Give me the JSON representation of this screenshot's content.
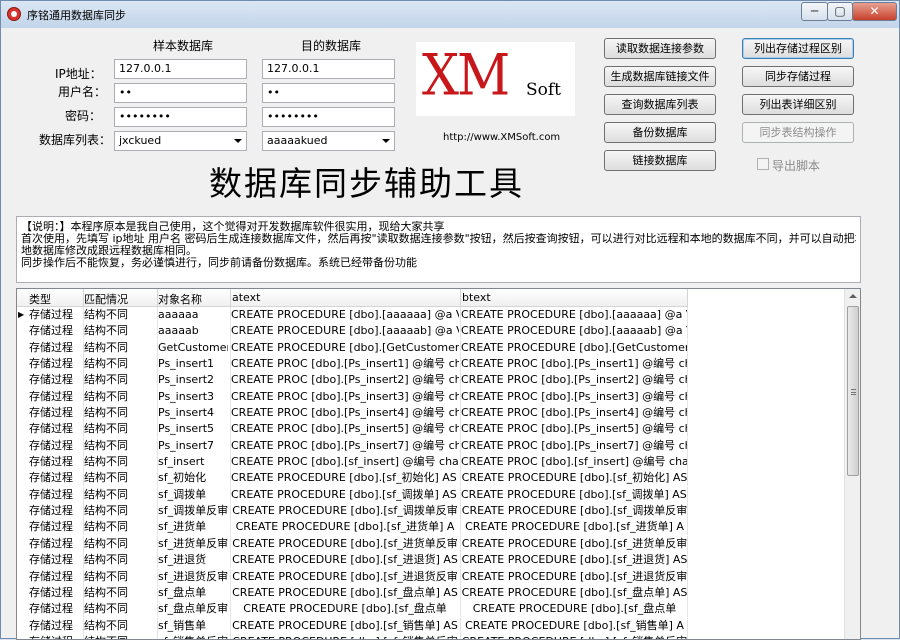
{
  "window": {
    "title": "序铭通用数据库同步",
    "min": "─",
    "max": "▢",
    "close": "✕"
  },
  "form": {
    "source_header": "样本数据库",
    "target_header": "目的数据库",
    "ip_label": "IP地址：",
    "user_label": "用户名：",
    "pwd_label": "密码：",
    "dblist_label": "数据库列表：",
    "source": {
      "ip": "127.0.0.1",
      "user": "••",
      "pwd": "••••••••",
      "db": "jxckued"
    },
    "target": {
      "ip": "127.0.0.1",
      "user": "••",
      "pwd": "••••••••",
      "db": "aaaaakued"
    }
  },
  "logo": {
    "xm": "XM",
    "soft": "Soft",
    "url": "http://www.XMSoft.com"
  },
  "app_title": "数据库同步辅助工具",
  "buttons": {
    "read_params": "读取数据连接参数",
    "gen_link": "生成数据库链接文件",
    "query_list": "查询数据库列表",
    "backup": "备份数据库",
    "link": "链接数据库",
    "list_proc_diff": "列出存储过程区别",
    "sync_proc": "同步存储过程",
    "list_table_diff": "列出表详细区别",
    "sync_table": "同步表结构操作",
    "export_script": "导出脚本"
  },
  "description": [
    "【说明：】本程序原本是我自己使用，这个觉得对开发数据库软件很实用，现给大家共享",
    "首次使用，先填写 ip地址 用户名 密码后生成连接数据库文件，然后再按\"读取数据连接参数\"按钮，然后按查询按钮，可以进行对比远程和本地的数据库不同，并可以自动把本",
    "地数据库修改成跟远程数据库相同。",
    "同步操作后不能恢复，务必谨慎进行，同步前请备份数据库。系统已经带备份功能"
  ],
  "grid": {
    "columns": [
      "类型",
      "匹配情况",
      "对象名称",
      "atext",
      "btext"
    ],
    "current_marker": "▶",
    "rows": [
      {
        "type": "存储过程",
        "match": "结构不同",
        "obj": "aaaaaa",
        "atext": "CREATE PROCEDURE  [dbo].[aaaaaa] @a VARC",
        "btext": "CREATE PROCEDURE  [dbo].[aaaaaa] @a VARC"
      },
      {
        "type": "存储过程",
        "match": "结构不同",
        "obj": "aaaaab",
        "atext": "CREATE PROCEDURE  [dbo].[aaaaab] @a VARC",
        "btext": "CREATE PROCEDURE  [dbo].[aaaaab] @a VARC"
      },
      {
        "type": "存储过程",
        "match": "结构不同",
        "obj": "GetCustomersBy",
        "atext": "CREATE PROCEDURE  [dbo].[GetCustomersByPa",
        "btext": "CREATE PROCEDURE  [dbo].[GetCustomersByPa"
      },
      {
        "type": "存储过程",
        "match": "结构不同",
        "obj": "Ps_insert1",
        "atext": "CREATE PROC [dbo].[Ps_insert1] @编号 char(2",
        "btext": "CREATE PROC [dbo].[Ps_insert1] @编号 char("
      },
      {
        "type": "存储过程",
        "match": "结构不同",
        "obj": "Ps_insert2",
        "atext": "CREATE PROC [dbo].[Ps_insert2] @编号 char(2",
        "btext": "CREATE PROC [dbo].[Ps_insert2] @编号 char("
      },
      {
        "type": "存储过程",
        "match": "结构不同",
        "obj": "Ps_insert3",
        "atext": "CREATE PROC [dbo].[Ps_insert3] @编号 char(2",
        "btext": "CREATE PROC [dbo].[Ps_insert3] @编号 char("
      },
      {
        "type": "存储过程",
        "match": "结构不同",
        "obj": "Ps_insert4",
        "atext": "CREATE PROC [dbo].[Ps_insert4] @编号 char(2",
        "btext": "CREATE PROC [dbo].[Ps_insert4] @编号 char("
      },
      {
        "type": "存储过程",
        "match": "结构不同",
        "obj": "Ps_insert5",
        "atext": "CREATE PROC [dbo].[Ps_insert5] @编号 char(2",
        "btext": "CREATE PROC [dbo].[Ps_insert5] @编号 char("
      },
      {
        "type": "存储过程",
        "match": "结构不同",
        "obj": "Ps_insert7",
        "atext": "CREATE PROC [dbo].[Ps_insert7] @编号 char(2",
        "btext": "CREATE PROC [dbo].[Ps_insert7] @编号 char("
      },
      {
        "type": "存储过程",
        "match": "结构不同",
        "obj": "sf_insert",
        "atext": "CREATE PROC [dbo].[sf_insert] @编号 char(20",
        "btext": "CREATE PROC [dbo].[sf_insert] @编号 char(20"
      },
      {
        "type": "存储过程",
        "match": "结构不同",
        "obj": "sf_初始化",
        "atext": "CREATE PROCEDURE [dbo].[sf_初始化] AS be",
        "btext": "CREATE PROCEDURE [dbo].[sf_初始化] AS"
      },
      {
        "type": "存储过程",
        "match": "结构不同",
        "obj": "sf_调拨单",
        "atext": "CREATE PROCEDURE [dbo].[sf_调拨单] AS be",
        "btext": "CREATE PROCEDURE [dbo].[sf_调拨单] AS b"
      },
      {
        "type": "存储过程",
        "match": "结构不同",
        "obj": "sf_调拨单反审",
        "atext": "CREATE PROCEDURE [dbo].[sf_调拨单反审",
        "btext": "CREATE PROCEDURE [dbo].[sf_调拨单反审"
      },
      {
        "type": "存储过程",
        "match": "结构不同",
        "obj": "sf_进货单",
        "atext": "CREATE PROCEDURE [dbo].[sf_进货单] A",
        "btext": "CREATE PROCEDURE [dbo].[sf_进货单] A"
      },
      {
        "type": "存储过程",
        "match": "结构不同",
        "obj": "sf_进货单反审",
        "atext": "CREATE PROCEDURE [dbo].[sf_进货单反审",
        "btext": "CREATE PROCEDURE [dbo].[sf_进货单反审"
      },
      {
        "type": "存储过程",
        "match": "结构不同",
        "obj": "sf_进退货",
        "atext": "CREATE PROCEDURE [dbo].[sf_进退货] AS",
        "btext": "CREATE PROCEDURE [dbo].[sf_进退货] AS"
      },
      {
        "type": "存储过程",
        "match": "结构不同",
        "obj": "sf_进退货反审",
        "atext": "CREATE PROCEDURE [dbo].[sf_进退货反审",
        "btext": "CREATE PROCEDURE [dbo].[sf_进退货反审"
      },
      {
        "type": "存储过程",
        "match": "结构不同",
        "obj": "sf_盘点单",
        "atext": "CREATE PROCEDURE [dbo].[sf_盘点单] AS",
        "btext": "CREATE PROCEDURE [dbo].[sf_盘点单] AS"
      },
      {
        "type": "存储过程",
        "match": "结构不同",
        "obj": "sf_盘点单反审",
        "atext": "CREATE PROCEDURE [dbo].[sf_盘点单",
        "btext": "CREATE PROCEDURE [dbo].[sf_盘点单"
      },
      {
        "type": "存储过程",
        "match": "结构不同",
        "obj": "sf_销售单",
        "atext": "CREATE PROCEDURE [dbo].[sf_销售单] AS",
        "btext": "CREATE PROCEDURE [dbo].[sf_销售单] A"
      },
      {
        "type": "存储过程",
        "match": "结构不同",
        "obj": "sf_销售单反审",
        "atext": "CREATE PROCEDURE [dbo].[sf_销售单反审",
        "btext": "CREATE PROCEDURE [dbo].[sf_销售单反审"
      }
    ]
  }
}
